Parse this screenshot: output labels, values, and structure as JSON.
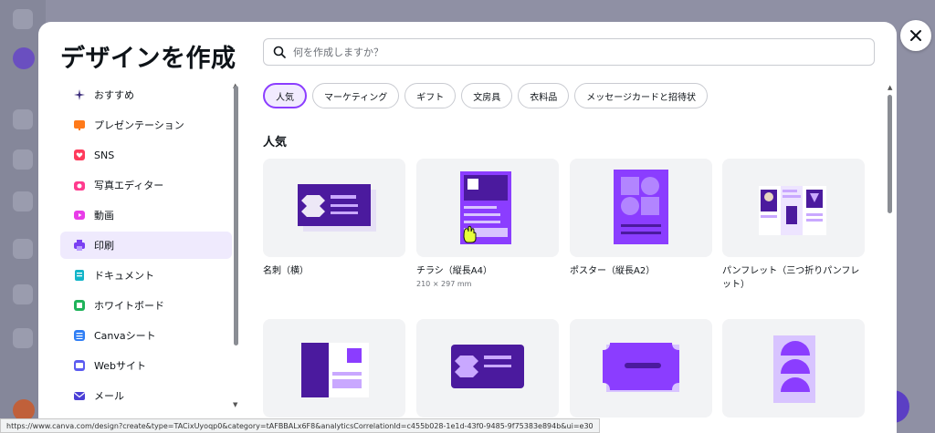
{
  "colors": {
    "accent": "#8b3dff",
    "active_bg": "#efeafd",
    "deep_purple": "#4b1a9e"
  },
  "dialog": {
    "title": "デザインを作成",
    "search": {
      "placeholder": "何を作成しますか？",
      "value": ""
    }
  },
  "sidebar": {
    "items": [
      {
        "label": "おすすめ",
        "icon": "sparkle-icon",
        "active": false
      },
      {
        "label": "プレゼンテーション",
        "icon": "presentation-icon",
        "active": false
      },
      {
        "label": "SNS",
        "icon": "heart-icon",
        "active": false
      },
      {
        "label": "写真エディター",
        "icon": "camera-icon",
        "active": false
      },
      {
        "label": "動画",
        "icon": "video-icon",
        "active": false
      },
      {
        "label": "印刷",
        "icon": "printer-icon",
        "active": true
      },
      {
        "label": "ドキュメント",
        "icon": "document-icon",
        "active": false
      },
      {
        "label": "ホワイトボード",
        "icon": "whiteboard-icon",
        "active": false
      },
      {
        "label": "Canvaシート",
        "icon": "sheet-icon",
        "active": false
      },
      {
        "label": "Webサイト",
        "icon": "website-icon",
        "active": false
      },
      {
        "label": "メール",
        "icon": "mail-icon",
        "active": false
      }
    ]
  },
  "chips": [
    {
      "label": "人気",
      "active": true
    },
    {
      "label": "マーケティング",
      "active": false
    },
    {
      "label": "ギフト",
      "active": false
    },
    {
      "label": "文房具",
      "active": false
    },
    {
      "label": "衣料品",
      "active": false
    },
    {
      "label": "メッセージカードと招待状",
      "active": false
    }
  ],
  "section": {
    "title": "人気"
  },
  "cards": [
    {
      "label": "名刺（横）",
      "sub": ""
    },
    {
      "label": "チラシ（縦長A4）",
      "sub": "210 × 297 mm"
    },
    {
      "label": "ポスター（縦長A2）",
      "sub": ""
    },
    {
      "label": "パンフレット（三つ折りパンフレット）",
      "sub": ""
    },
    {
      "label": "",
      "sub": ""
    },
    {
      "label": "",
      "sub": ""
    },
    {
      "label": "",
      "sub": ""
    },
    {
      "label": "",
      "sub": ""
    }
  ],
  "status_url": "https://www.canva.com/design?create&type=TACixUyoqp0&category=tAFBBALx6F8&analyticsCorrelationId=c455b028-1e1d-43f0-9485-9f75383e894b&ui=e30"
}
